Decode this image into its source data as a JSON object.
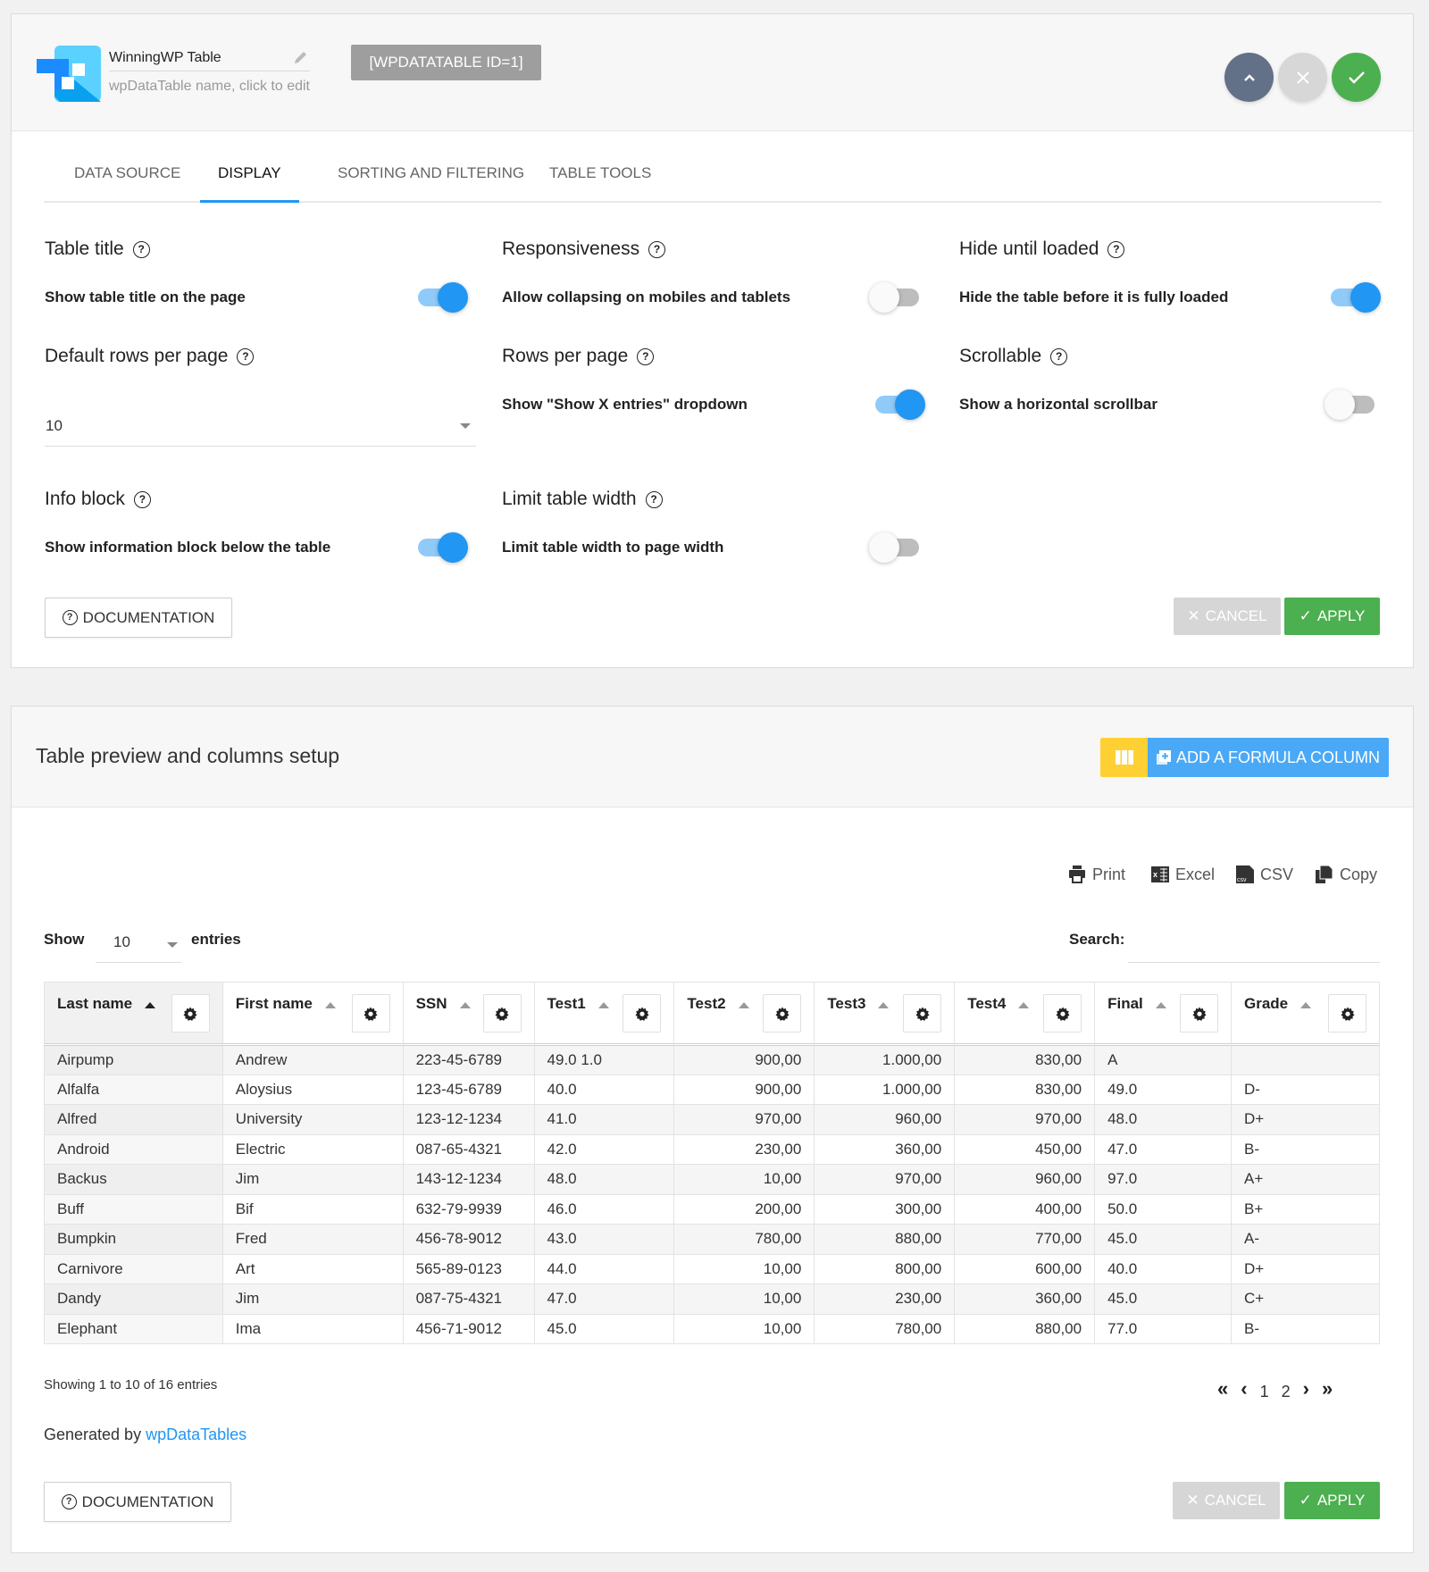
{
  "header": {
    "table_name": "WinningWP Table",
    "name_hint": "wpDataTable name, click to edit",
    "shortcode": "[WPDATATABLE ID=1]",
    "collapse_icon": "chevron-up-icon",
    "close_icon": "close-icon",
    "save_icon": "check-icon"
  },
  "tabs": [
    {
      "label": "DATA SOURCE",
      "active": false
    },
    {
      "label": "DISPLAY",
      "active": true
    },
    {
      "label": "SORTING AND FILTERING",
      "active": false
    },
    {
      "label": "TABLE TOOLS",
      "active": false
    }
  ],
  "display_settings": {
    "table_title": {
      "title": "Table title",
      "label": "Show table title on the page",
      "enabled": true
    },
    "responsiveness": {
      "title": "Responsiveness",
      "label": "Allow collapsing on mobiles and tablets",
      "enabled": false
    },
    "hide_until_loaded": {
      "title": "Hide until loaded",
      "label": "Hide the table before it is fully loaded",
      "enabled": true
    },
    "default_rows": {
      "title": "Default rows per page",
      "value": "10"
    },
    "rows_per_page": {
      "title": "Rows per page",
      "label": "Show \"Show X entries\" dropdown",
      "enabled": true
    },
    "scrollable": {
      "title": "Scrollable",
      "label": "Show a horizontal scrollbar",
      "enabled": false
    },
    "info_block": {
      "title": "Info block",
      "label": "Show information block below the table",
      "enabled": true
    },
    "limit_width": {
      "title": "Limit table width",
      "label": "Limit table width to page width",
      "enabled": false
    }
  },
  "buttons": {
    "documentation": "DOCUMENTATION",
    "cancel": "CANCEL",
    "apply": "APPLY"
  },
  "preview": {
    "title": "Table preview and columns setup",
    "add_formula_label": "ADD A FORMULA COLUMN",
    "exports": [
      {
        "label": "Print",
        "icon": "print-icon"
      },
      {
        "label": "Excel",
        "icon": "excel-icon"
      },
      {
        "label": "CSV",
        "icon": "csv-icon"
      },
      {
        "label": "Copy",
        "icon": "copy-icon"
      }
    ],
    "show_label": "Show",
    "show_value": "10",
    "entries_label": "entries",
    "search_label": "Search:",
    "search_value": "",
    "columns": [
      "Last name",
      "First name",
      "SSN",
      "Test1",
      "Test2",
      "Test3",
      "Test4",
      "Final",
      "Grade"
    ],
    "numeric_columns": [
      4,
      5,
      6
    ],
    "rows": [
      [
        "Airpump",
        "Andrew",
        "223-45-6789",
        "49.0 1.0",
        "900,00",
        "1.000,00",
        "830,00",
        "A",
        ""
      ],
      [
        "Alfalfa",
        "Aloysius",
        "123-45-6789",
        "40.0",
        "900,00",
        "1.000,00",
        "830,00",
        "49.0",
        "D-"
      ],
      [
        "Alfred",
        "University",
        "123-12-1234",
        "41.0",
        "970,00",
        "960,00",
        "970,00",
        "48.0",
        "D+"
      ],
      [
        "Android",
        "Electric",
        "087-65-4321",
        "42.0",
        "230,00",
        "360,00",
        "450,00",
        "47.0",
        "B-"
      ],
      [
        "Backus",
        "Jim",
        "143-12-1234",
        "48.0",
        "10,00",
        "970,00",
        "960,00",
        "97.0",
        "A+"
      ],
      [
        "Buff",
        "Bif",
        "632-79-9939",
        "46.0",
        "200,00",
        "300,00",
        "400,00",
        "50.0",
        "B+"
      ],
      [
        "Bumpkin",
        "Fred",
        "456-78-9012",
        "43.0",
        "780,00",
        "880,00",
        "770,00",
        "45.0",
        "A-"
      ],
      [
        "Carnivore",
        "Art",
        "565-89-0123",
        "44.0",
        "10,00",
        "800,00",
        "600,00",
        "40.0",
        "D+"
      ],
      [
        "Dandy",
        "Jim",
        "087-75-4321",
        "47.0",
        "10,00",
        "230,00",
        "360,00",
        "45.0",
        "C+"
      ],
      [
        "Elephant",
        "Ima",
        "456-71-9012",
        "45.0",
        "10,00",
        "780,00",
        "880,00",
        "77.0",
        "B-"
      ]
    ],
    "info_text": "Showing 1 to 10 of 16 entries",
    "generated_by": "Generated by",
    "generated_link": "wpDataTables",
    "pagination": {
      "pages": [
        "1",
        "2"
      ],
      "current": "1"
    }
  },
  "colors": {
    "primary": "#2196f3",
    "success": "#4caf50",
    "collapse": "#637188",
    "muted": "#d6d6d6",
    "columns_button": "#ffd033",
    "formula_button": "#4aa9f6"
  }
}
